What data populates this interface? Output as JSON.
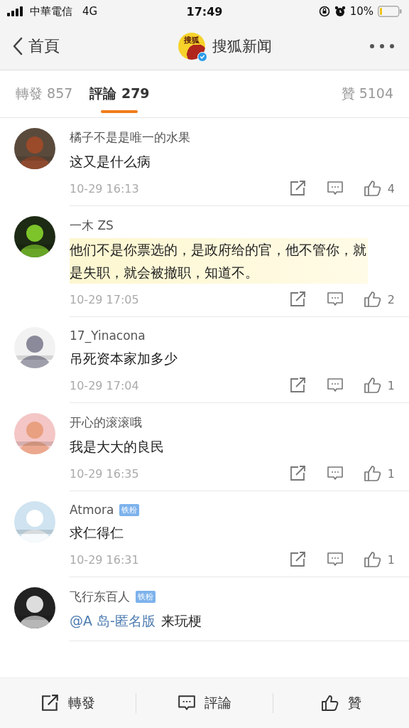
{
  "status_bar": {
    "carrier": "中華電信",
    "network": "4G",
    "time": "17:49",
    "battery": "10%"
  },
  "nav": {
    "back": "首頁",
    "logo_text": "搜狐",
    "title": "搜狐新闻",
    "verified": true
  },
  "tabs": [
    {
      "label": "轉發",
      "count": "857",
      "selected": false
    },
    {
      "label": "評論",
      "count": "279",
      "selected": true
    },
    {
      "label": "贊",
      "count": "5104",
      "selected": false
    }
  ],
  "comments": [
    {
      "user": "橘子不是是唯一的水果",
      "text": "这又是什么病",
      "highlighted": false,
      "time": "10-29 16:13",
      "likes": "4"
    },
    {
      "user": "一木 ZS",
      "text": "他们不是你票选的，是政府给的官，他不管你，就是失职，就会被撤职，知道不。",
      "highlighted": true,
      "time": "10-29 17:05",
      "likes": "2"
    },
    {
      "user": "17_Yinacona",
      "text": "吊死资本家加多少",
      "highlighted": false,
      "time": "10-29 17:04",
      "likes": "1"
    },
    {
      "user": "开心的滚滚哦",
      "text": "我是大大的良民",
      "highlighted": false,
      "time": "10-29 16:35",
      "likes": "1"
    },
    {
      "user": "Atmora",
      "badge": "铁粉",
      "text": "求仁得仁",
      "highlighted": false,
      "time": "10-29 16:31",
      "likes": "1"
    },
    {
      "user": "飞行东百人",
      "badge": "铁粉",
      "mention": "@A 岛-匿名版",
      "text": "来玩梗",
      "highlighted": false
    }
  ],
  "bottom_bar": [
    {
      "kind": "repost",
      "label": "轉發"
    },
    {
      "kind": "comment",
      "label": "評論"
    },
    {
      "kind": "like",
      "label": "贊"
    }
  ]
}
